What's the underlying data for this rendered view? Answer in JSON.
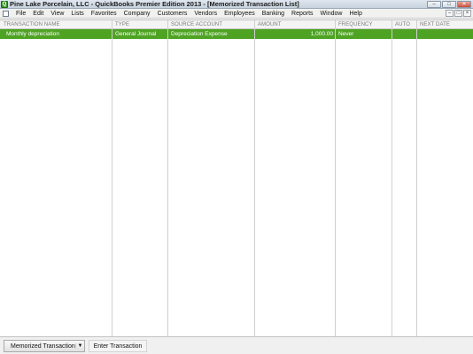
{
  "window": {
    "title": "Pine Lake Porcelain, LLC  - QuickBooks Premier Edition 2013 - [Memorized Transaction List]",
    "app_icon": "quickbooks-logo-icon",
    "controls": [
      "minimize",
      "maximize",
      "close"
    ]
  },
  "menubar": {
    "items": [
      "File",
      "Edit",
      "View",
      "Lists",
      "Favorites",
      "Company",
      "Customers",
      "Vendors",
      "Employees",
      "Banking",
      "Reports",
      "Window",
      "Help"
    ]
  },
  "table": {
    "columns": [
      "TRANSACTION NAME",
      "TYPE",
      "SOURCE ACCOUNT",
      "AMOUNT",
      "FREQUENCY",
      "AUTO",
      "NEXT DATE"
    ],
    "rows": [
      {
        "name": "Monthly depreciation",
        "type": "General Journal",
        "source_account": "Depreciation Expense",
        "amount": "1,000.00",
        "frequency": "Never",
        "auto": "",
        "next_date": ""
      }
    ],
    "selected_row_color": "#4ea323"
  },
  "bottombar": {
    "memorized_button": "Memorized Transaction",
    "enter_button": "Enter Transaction"
  }
}
